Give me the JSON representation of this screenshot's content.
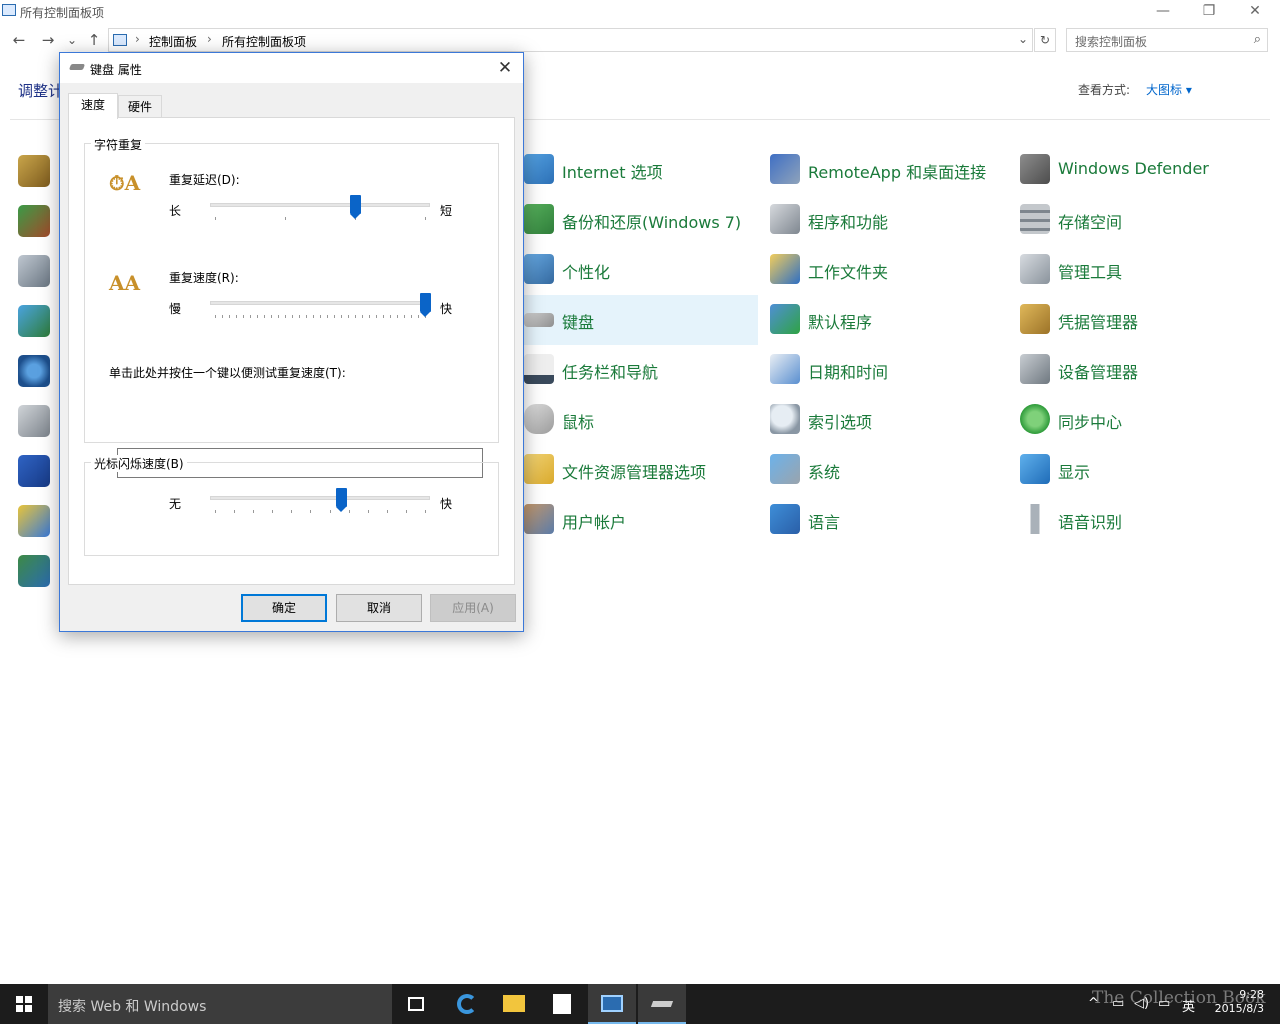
{
  "window": {
    "title": "所有控制面板项",
    "minimize": "—",
    "restore": "❐",
    "close": "✕"
  },
  "nav": {
    "back": "←",
    "forward": "→",
    "recent": "⌄",
    "up": "↑",
    "breadcrumb": [
      "控制面板",
      "所有控制面板项"
    ],
    "separator": "›",
    "dropdown": "⌄",
    "refresh": "↻",
    "search_placeholder": "搜索控制面板",
    "search_icon": "⌕"
  },
  "header": {
    "title_partial": "调整计",
    "view_by_label": "查看方式:",
    "view_by_value": "大图标 ▾"
  },
  "items": {
    "col1": [
      "Internet 选项",
      "备份和还原(Windows 7)",
      "个性化",
      "键盘",
      "任务栏和导航",
      "鼠标",
      "文件资源管理器选项",
      "用户帐户"
    ],
    "col2": [
      "RemoteApp 和桌面连接",
      "程序和功能",
      "工作文件夹",
      "默认程序",
      "日期和时间",
      "索引选项",
      "系统",
      "语言"
    ],
    "col3": [
      "Windows Defender",
      "存储空间",
      "管理工具",
      "凭据管理器",
      "设备管理器",
      "同步中心",
      "显示",
      "语音识别"
    ]
  },
  "dialog": {
    "title": "键盘 属性",
    "close": "✕",
    "tabs": [
      "速度",
      "硬件"
    ],
    "char_repeat": {
      "group_label": "字符重复",
      "delay_label": "重复延迟(D):",
      "delay_low": "长",
      "delay_high": "短",
      "delay_level": 0.667,
      "rate_label": "重复速度(R):",
      "rate_low": "慢",
      "rate_high": "快",
      "rate_level": 1.0,
      "test_label": "单击此处并按住一个键以便测试重复速度(T):",
      "test_value": ""
    },
    "cursor_blink": {
      "group_label": "光标闪烁速度(B)",
      "low": "无",
      "high": "快",
      "level": 0.6
    },
    "buttons": {
      "ok": "确定",
      "cancel": "取消",
      "apply": "应用(A)"
    }
  },
  "taskbar": {
    "search_placeholder": "搜索 Web 和 Windows",
    "time": "9:28",
    "date": "2015/8/3",
    "ime": "英",
    "tray_arrow": "^"
  },
  "watermark": "The Collection Book",
  "colors": {
    "link_green": "#1a7a3a",
    "accent_blue": "#0078d7",
    "taskbar_bg": "#1c1c1c"
  }
}
